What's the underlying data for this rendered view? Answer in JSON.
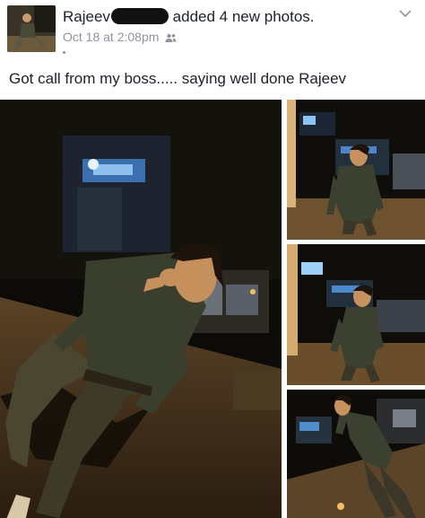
{
  "post": {
    "author": "Rajeev",
    "action": "added 4 new photos.",
    "date": "Oct 18 at 2:08pm",
    "privacy_icon": "friends-icon",
    "menu_icon": "chevron-down-icon",
    "text": "Got call from my boss..... saying well done Rajeev"
  },
  "photos": {
    "count": 4,
    "items": [
      "main-photo",
      "thumbnail-1",
      "thumbnail-2",
      "thumbnail-3"
    ]
  },
  "colors": {
    "text": "#1d2129",
    "meta": "#90949c",
    "redaction": "#111111"
  }
}
